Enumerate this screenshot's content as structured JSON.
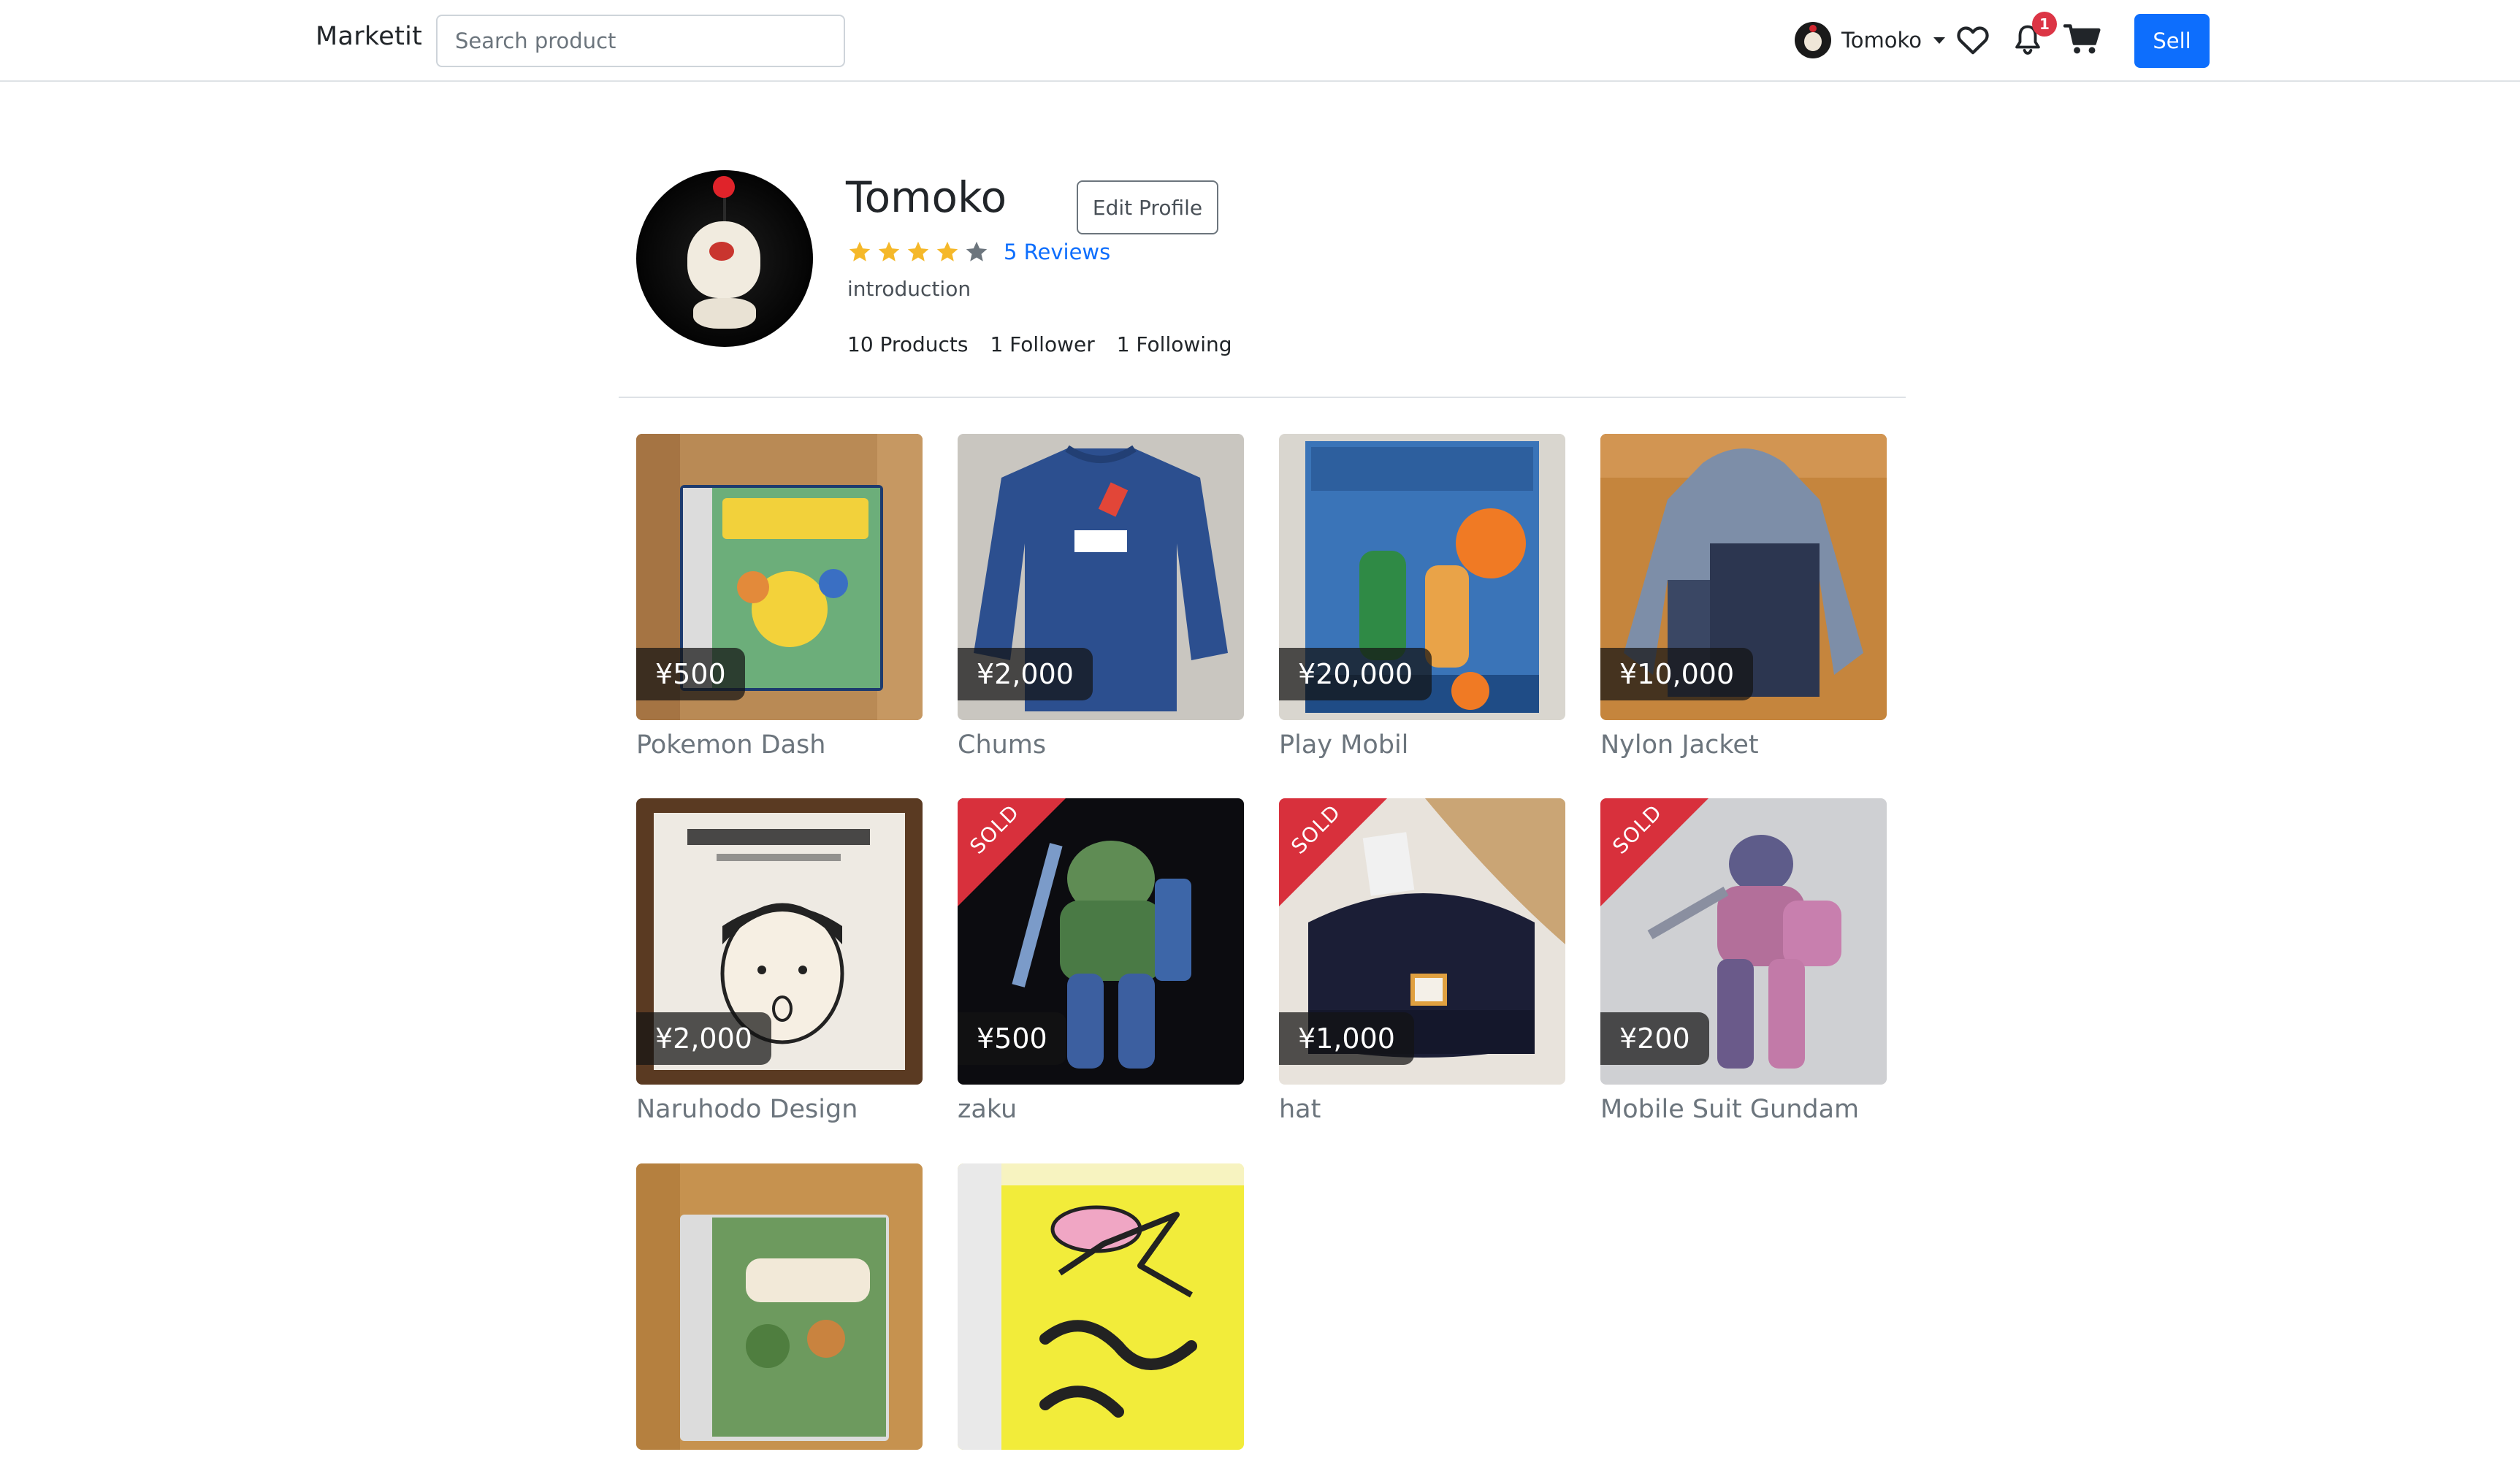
{
  "navbar": {
    "brand": "Marketit",
    "search_placeholder": "Search product",
    "user_name": "Tomoko",
    "notification_count": "1",
    "sell_label": "Sell"
  },
  "profile": {
    "name": "Tomoko",
    "edit_label": "Edit Profile",
    "rating": 4,
    "rating_max": 5,
    "reviews_label": "5 Reviews",
    "intro": "introduction",
    "products": "10 Products",
    "followers": "1 Follower",
    "following": "1 Following"
  },
  "products": [
    {
      "title": "Pokemon Dash",
      "price": "¥500",
      "sold": false
    },
    {
      "title": "Chums",
      "price": "¥2,000",
      "sold": false
    },
    {
      "title": "Play Mobil",
      "price": "¥20,000",
      "sold": false
    },
    {
      "title": "Nylon Jacket",
      "price": "¥10,000",
      "sold": false
    },
    {
      "title": "Naruhodo Design",
      "price": "¥2,000",
      "sold": false
    },
    {
      "title": "zaku",
      "price": "¥500",
      "sold": true
    },
    {
      "title": "hat",
      "price": "¥1,000",
      "sold": true
    },
    {
      "title": "Mobile Suit Gundam",
      "price": "¥200",
      "sold": true
    },
    {
      "title": "",
      "price": "",
      "sold": false
    },
    {
      "title": "",
      "price": "",
      "sold": false
    }
  ],
  "sold_label": "SOLD",
  "colors": {
    "primary": "#0d6efd",
    "danger": "#dc3545",
    "sold_ribbon": "#d8303c",
    "star_filled": "#f5b829",
    "star_empty": "#6c757d"
  }
}
